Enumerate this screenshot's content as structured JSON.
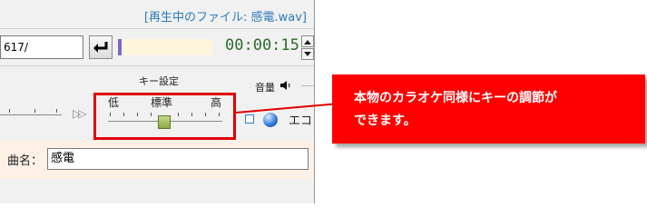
{
  "header": {
    "now_playing": "[再生中のファイル: 感電.wav]"
  },
  "path": {
    "value": "617/"
  },
  "playback": {
    "time": "00:00:15",
    "progress_percent": 0
  },
  "key": {
    "title": "キー設定",
    "low": "低",
    "standard": "標準",
    "high": "高"
  },
  "volume": {
    "label": "音量"
  },
  "eco": {
    "label": "エコ"
  },
  "song": {
    "label": "曲名：",
    "value": "感電"
  },
  "callout": {
    "line1": "本物のカラオケ同様にキーの調節が",
    "line2": "できます。"
  },
  "colors": {
    "highlight": "#e00000",
    "time_text": "#2e6b28",
    "now_playing_text": "#2a7bbd"
  },
  "icons": {
    "enter": "enter-return-icon",
    "speaker": "speaker-icon",
    "fast_forward": "fast-forward-icon"
  }
}
